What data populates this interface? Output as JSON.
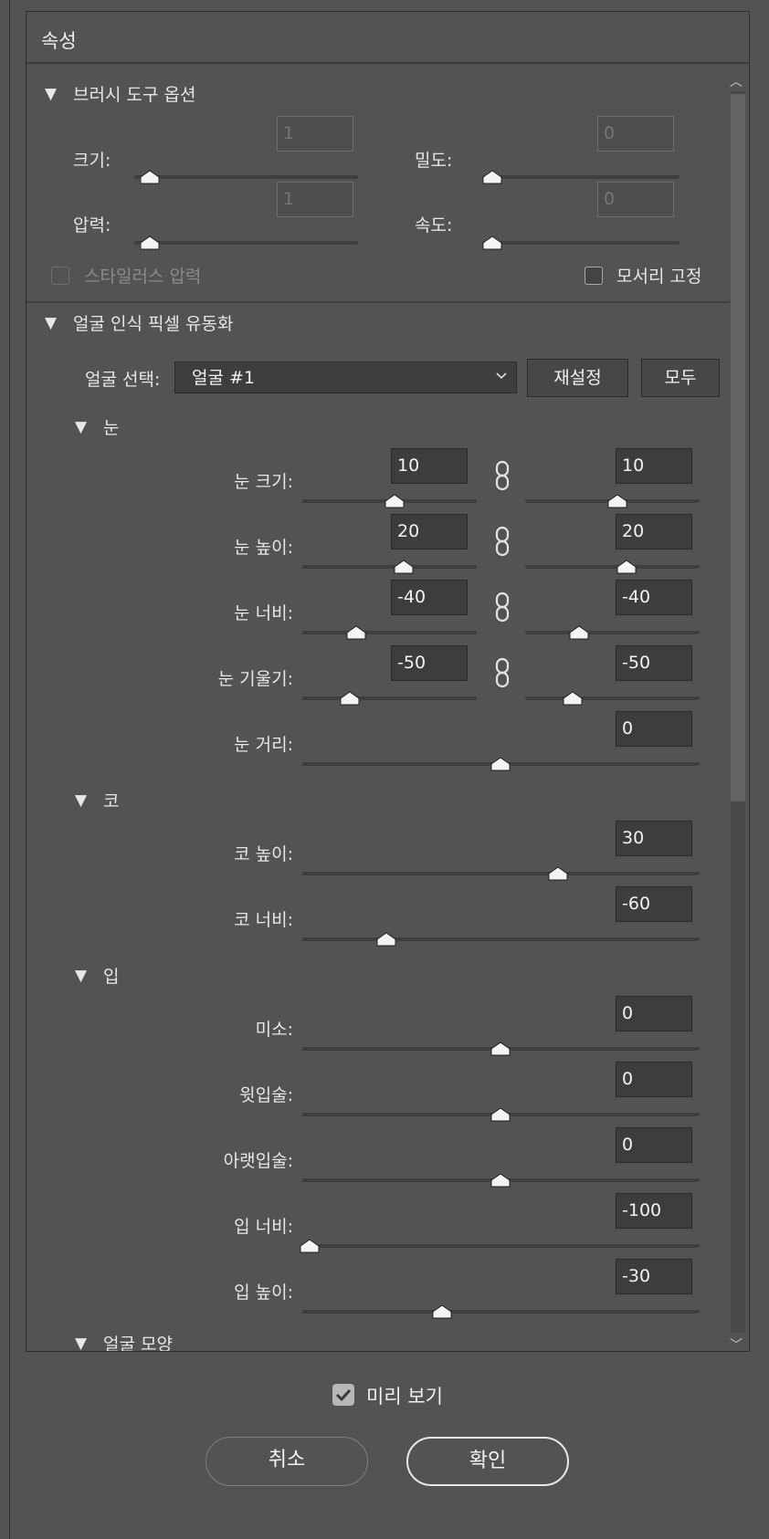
{
  "panel": {
    "title": "속성"
  },
  "brush_options": {
    "header": "브러시 도구 옵션",
    "size_label": "크기:",
    "size_value": "1",
    "density_label": "밀도:",
    "density_value": "0",
    "pressure_label": "압력:",
    "pressure_value": "1",
    "rate_label": "속도:",
    "rate_value": "0",
    "stylus_label": "스타일러스 압력",
    "pin_edges_label": "모서리 고정"
  },
  "face_liquify": {
    "header": "얼굴 인식 픽셀 유동화",
    "face_select_label": "얼굴 선택:",
    "face_select_value": "얼굴 #1",
    "reset_button": "재설정",
    "all_button": "모두",
    "eyes": {
      "header": "눈",
      "rows": [
        {
          "label": "눈 크기:",
          "left": "10",
          "right": "10",
          "left_pos": 0.53,
          "right_pos": 0.53
        },
        {
          "label": "눈 높이:",
          "left": "20",
          "right": "20",
          "left_pos": 0.58,
          "right_pos": 0.58
        },
        {
          "label": "눈 너비:",
          "left": "-40",
          "right": "-40",
          "left_pos": 0.31,
          "right_pos": 0.31
        },
        {
          "label": "눈 기울기:",
          "left": "-50",
          "right": "-50",
          "left_pos": 0.27,
          "right_pos": 0.27
        }
      ],
      "distance_label": "눈 거리:",
      "distance_value": "0"
    },
    "nose": {
      "header": "코",
      "height_label": "코 높이:",
      "height_value": "30",
      "width_label": "코 너비:",
      "width_value": "-60"
    },
    "mouth": {
      "header": "입",
      "smile_label": "미소:",
      "smile_value": "0",
      "upper_lip_label": "윗입술:",
      "upper_lip_value": "0",
      "lower_lip_label": "아랫입술:",
      "lower_lip_value": "0",
      "width_label": "입 너비:",
      "width_value": "-100",
      "height_label": "입 높이:",
      "height_value": "-30"
    },
    "face_shape_header": "얼굴 모양"
  },
  "footer": {
    "preview_label": "미리 보기",
    "preview_checked": true,
    "cancel_button": "취소",
    "ok_button": "확인"
  },
  "icons": {
    "collapse": "triangle-down-icon",
    "link": "chain-link-icon",
    "dropdown": "chevron-down-icon",
    "scroll_up": "scroll-up-arrow-icon",
    "scroll_down": "scroll-down-arrow-icon",
    "check": "checkmark-icon"
  }
}
